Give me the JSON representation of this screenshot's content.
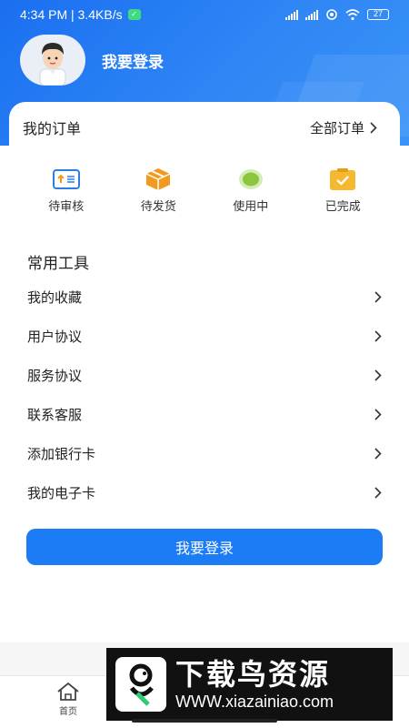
{
  "status_bar": {
    "time_speed": "4:34 PM | 3.4KB/s",
    "battery": "27"
  },
  "profile": {
    "login_title": "我要登录",
    "avatar_icon": "male-avatar-icon"
  },
  "orders": {
    "title": "我的订单",
    "all_label": "全部订单",
    "items": [
      {
        "label": "待审核",
        "icon": "review-icon",
        "color": "#2b7de9"
      },
      {
        "label": "待发货",
        "icon": "package-icon",
        "color": "#f39a1e"
      },
      {
        "label": "使用中",
        "icon": "in-use-icon",
        "color": "#8cc63f"
      },
      {
        "label": "已完成",
        "icon": "done-icon",
        "color": "#f5b82e"
      }
    ]
  },
  "tools": {
    "title": "常用工具",
    "items": [
      {
        "label": "我的收藏"
      },
      {
        "label": "用户协议"
      },
      {
        "label": "服务协议"
      },
      {
        "label": "联系客服"
      },
      {
        "label": "添加银行卡"
      },
      {
        "label": "我的电子卡"
      }
    ]
  },
  "login_button": "我要登录",
  "tabbar": {
    "home_label": "首页"
  },
  "watermark": {
    "title": "下载鸟资源",
    "url": "WWW.xiazainiao.com"
  },
  "colors": {
    "accent": "#1c7cf5",
    "header": "#2f86f5"
  }
}
